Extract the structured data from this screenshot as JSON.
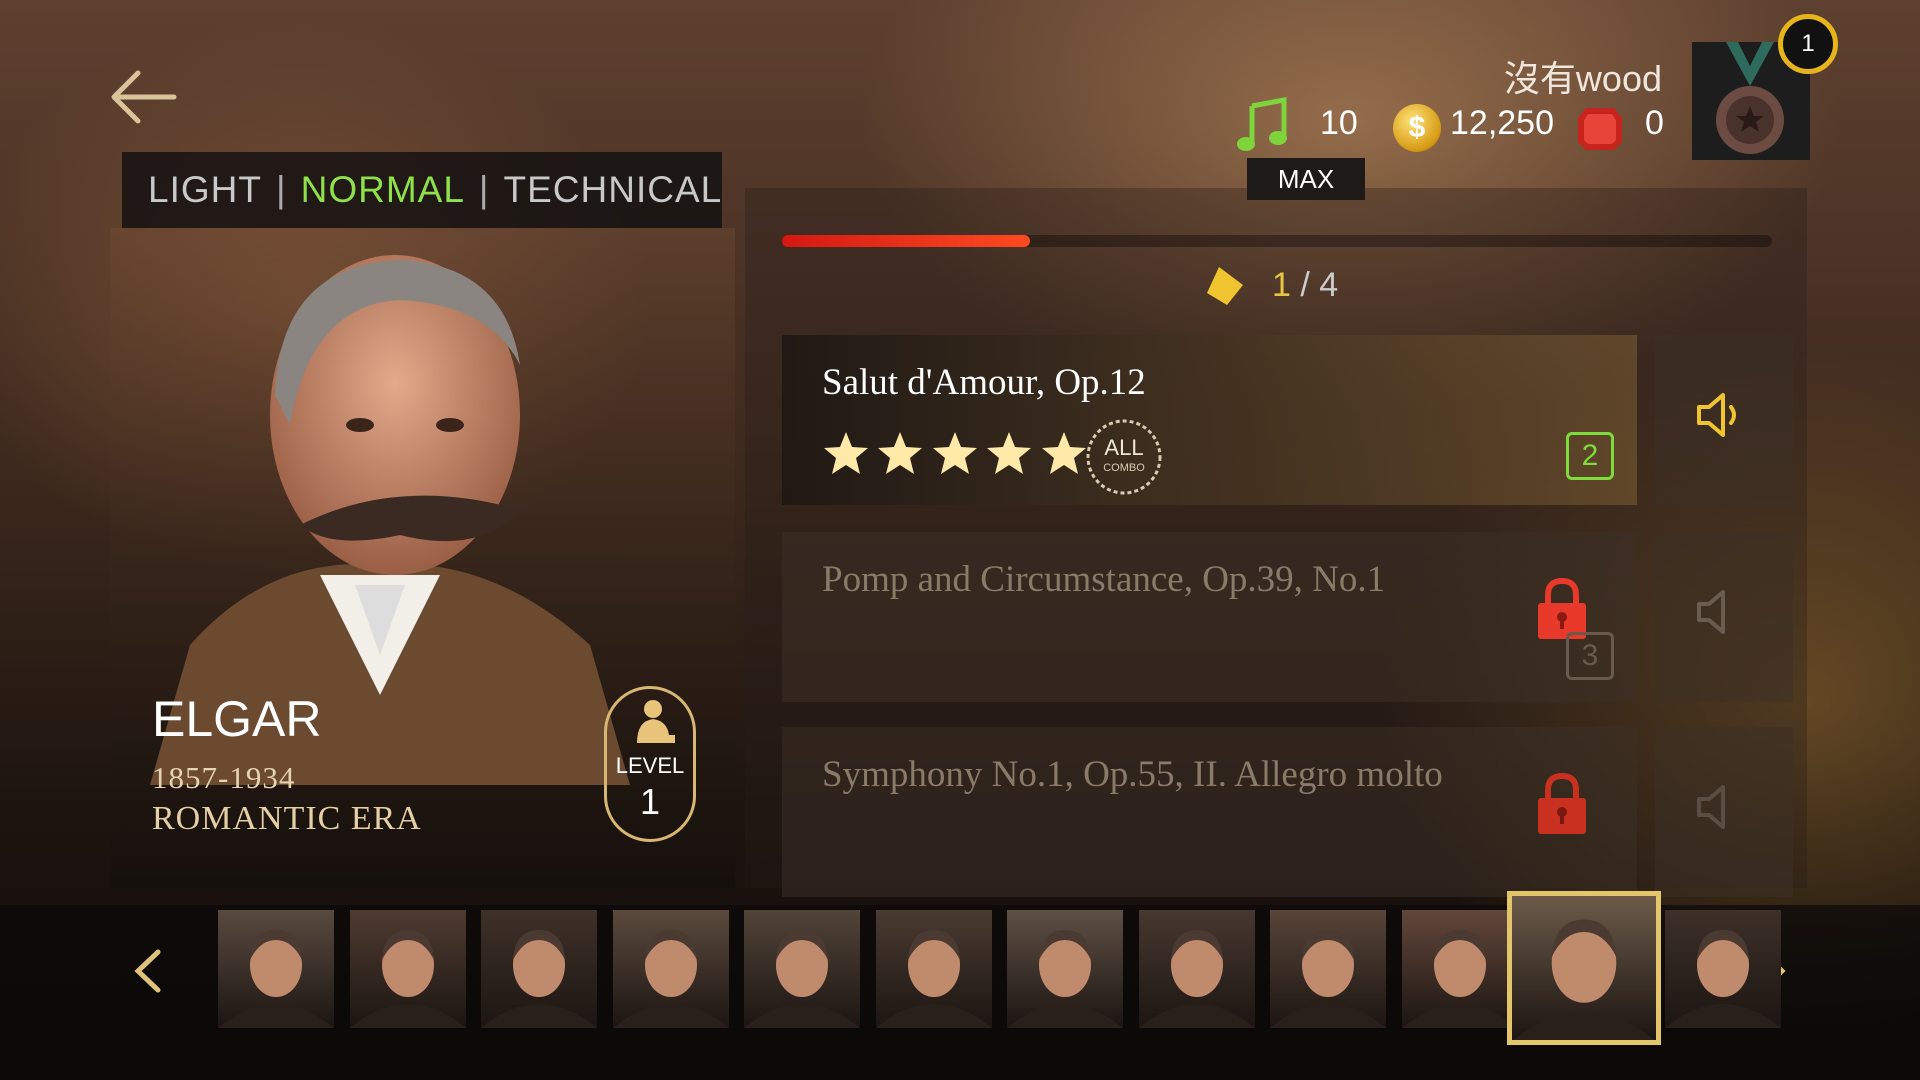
{
  "header": {
    "player_name": "沒有wood",
    "notes": "10",
    "notes_state": "MAX",
    "coins": "12,250",
    "gems": "0",
    "rank": "1"
  },
  "difficulty": {
    "options": [
      "LIGHT",
      "NORMAL",
      "TECHNICAL"
    ],
    "selected": "NORMAL"
  },
  "composer": {
    "name": "ELGAR",
    "dates": "1857-1934",
    "era": "ROMANTIC ERA",
    "level_label": "LEVEL",
    "level": "1"
  },
  "progress": {
    "fraction": 0.25,
    "current": "1",
    "separator": " / ",
    "total": "4"
  },
  "songs": [
    {
      "title": "Salut d'Amour, Op.12",
      "stars": 5,
      "badge": "ALL",
      "badge_sub": "COMBO",
      "number": "2",
      "locked": false
    },
    {
      "title": "Pomp and Circumstance, Op.39, No.1",
      "number": "3",
      "locked": true
    },
    {
      "title": "Symphony No.1, Op.55, II. Allegro molto",
      "locked": true
    }
  ],
  "composer_strip": {
    "count": 12,
    "selected_index": 10
  },
  "colors": {
    "accent_green": "#8fe04a",
    "progress_red": "#d51812",
    "gold": "#e3c66b",
    "lock_red": "#e8392a"
  }
}
